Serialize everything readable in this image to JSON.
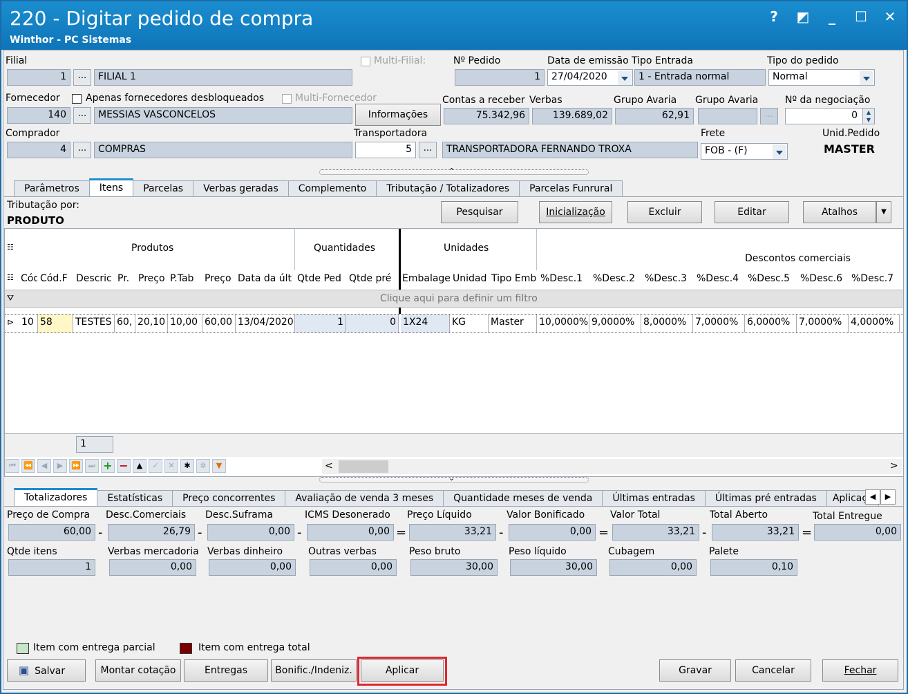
{
  "window": {
    "title": "220 - Digitar pedido de compra",
    "subtitle": "Winthor - PC Sistemas",
    "help": "?",
    "minimize": "_"
  },
  "header": {
    "filial_label": "Filial",
    "filial_code": "1",
    "filial_name": "FILIAL 1",
    "multi_filial_label": "Multi-Filial:",
    "pedido_label": "Nº Pedido",
    "pedido_value": "1",
    "emissao_label": "Data de emissão",
    "emissao_value": "27/04/2020",
    "tipo_entrada_label": "Tipo Entrada",
    "tipo_entrada_value": "1 - Entrada normal",
    "tipo_pedido_label": "Tipo do pedido",
    "tipo_pedido_value": "Normal",
    "fornecedor_label": "Fornecedor",
    "apenas_label": "Apenas fornecedores desbloqueados",
    "multi_fornecedor_label": "Multi-Fornecedor",
    "fornecedor_code": "140",
    "fornecedor_name": "MESSIAS VASCONCELOS",
    "informacoes_label": "Informações",
    "contas_label": "Contas a receber",
    "contas_value": "75.342,96",
    "verbas_label": "Verbas",
    "verbas_value": "139.689,02",
    "grupo_avaria_label": "Grupo Avaria",
    "grupo_avaria_value": "62,91",
    "grupo_avaria2_label": "Grupo Avaria",
    "negociacao_label": "Nº da negociação",
    "negociacao_value": "0",
    "comprador_label": "Comprador",
    "comprador_code": "4",
    "comprador_name": "COMPRAS",
    "transportadora_label": "Transportadora",
    "transportadora_code": "5",
    "transportadora_name": "TRANSPORTADORA FERNANDO TROXA",
    "frete_label": "Frete",
    "frete_value": "FOB - (F)",
    "unid_pedido_label": "Unid.Pedido",
    "unid_pedido_value": "MASTER",
    "ellipsis": "..."
  },
  "tabs_top": [
    "Parâmetros",
    "Itens",
    "Parcelas",
    "Verbas geradas",
    "Complemento",
    "Tributação / Totalizadores",
    "Parcelas Funrural"
  ],
  "itens": {
    "tributacao_label": "Tributação por:",
    "tributacao_value": "PRODUTO",
    "pesquisar": "Pesquisar",
    "inicializacao": "Inicialização",
    "excluir": "Excluir",
    "editar": "Editar",
    "atalhos": "Atalhos"
  },
  "grid": {
    "bands": {
      "produtos": "Produtos",
      "quantidades": "Quantidades",
      "unidades": "Unidades",
      "descontos": "Descontos comerciais"
    },
    "columns": [
      "Cód",
      "Cód.F",
      "Descric",
      "Pr.",
      "Preço",
      "P.Tab",
      "Preço",
      "Data da últ",
      "Qtde Ped",
      "Qtde pré",
      "Embalage",
      "Unidad",
      "Tipo Emb",
      "%Desc.1",
      "%Desc.2",
      "%Desc.3",
      "%Desc.4",
      "%Desc.5",
      "%Desc.6",
      "%Desc.7"
    ],
    "filter_hint": "Clique aqui para definir um filtro",
    "row": [
      "10",
      "58",
      "TESTES",
      "60,",
      "20,10",
      "10,00",
      "60,00",
      "13/04/2020",
      "1",
      "0",
      "1X24",
      "KG",
      "Master",
      "10,0000%",
      "9,0000%",
      "8,0000%",
      "7,0000%",
      "6,0000%",
      "7,0000%",
      "4,0000%"
    ],
    "footer_count": "1"
  },
  "tabs_bottom": [
    "Totalizadores",
    "Estatísticas",
    "Preço concorrentes",
    "Avaliação de venda 3 meses",
    "Quantidade meses de venda",
    "Últimas entradas",
    "Últimas pré entradas",
    "Aplicaçõe"
  ],
  "totals": {
    "preco_compra_label": "Preço de Compra",
    "preco_compra": "60,00",
    "desc_com_label": "Desc.Comerciais",
    "desc_com": "26,79",
    "desc_suf_label": "Desc.Suframa",
    "desc_suf": "0,00",
    "icms_label": "ICMS Desonerado",
    "icms": "0,00",
    "preco_liq_label": "Preço Líquido",
    "preco_liq": "33,21",
    "valor_bon_label": "Valor Bonificado",
    "valor_bon": "0,00",
    "valor_total_label": "Valor Total",
    "valor_total": "33,21",
    "total_aberto_label": "Total Aberto",
    "total_aberto": "33,21",
    "total_entregue_label": "Total Entregue",
    "total_entregue": "0,00",
    "qtde_label": "Qtde itens",
    "qtde": "1",
    "verbas_merc_label": "Verbas mercadoria",
    "verbas_merc": "0,00",
    "verbas_din_label": "Verbas dinheiro",
    "verbas_din": "0,00",
    "outras_label": "Outras verbas",
    "outras": "0,00",
    "peso_bruto_label": "Peso bruto",
    "peso_bruto": "30,00",
    "peso_liq_label": "Peso líquido",
    "peso_liq": "30,00",
    "cubagem_label": "Cubagem",
    "cubagem": "0,00",
    "palete_label": "Palete",
    "palete": "0,10",
    "minus": "-",
    "equals": "="
  },
  "legend": {
    "parcial": "Item com entrega parcial",
    "total": "Item com entrega total",
    "parcial_color": "#c8e6c9",
    "total_color": "#7a0000"
  },
  "footer": {
    "salvar": "Salvar",
    "montar": "Montar cotação",
    "entregas": "Entregas",
    "bonific": "Bonific./Indeniz.",
    "aplicar": "Aplicar",
    "gravar": "Gravar",
    "cancelar": "Cancelar",
    "fechar": "Fechar",
    "highlight_color": "#e0282e"
  }
}
